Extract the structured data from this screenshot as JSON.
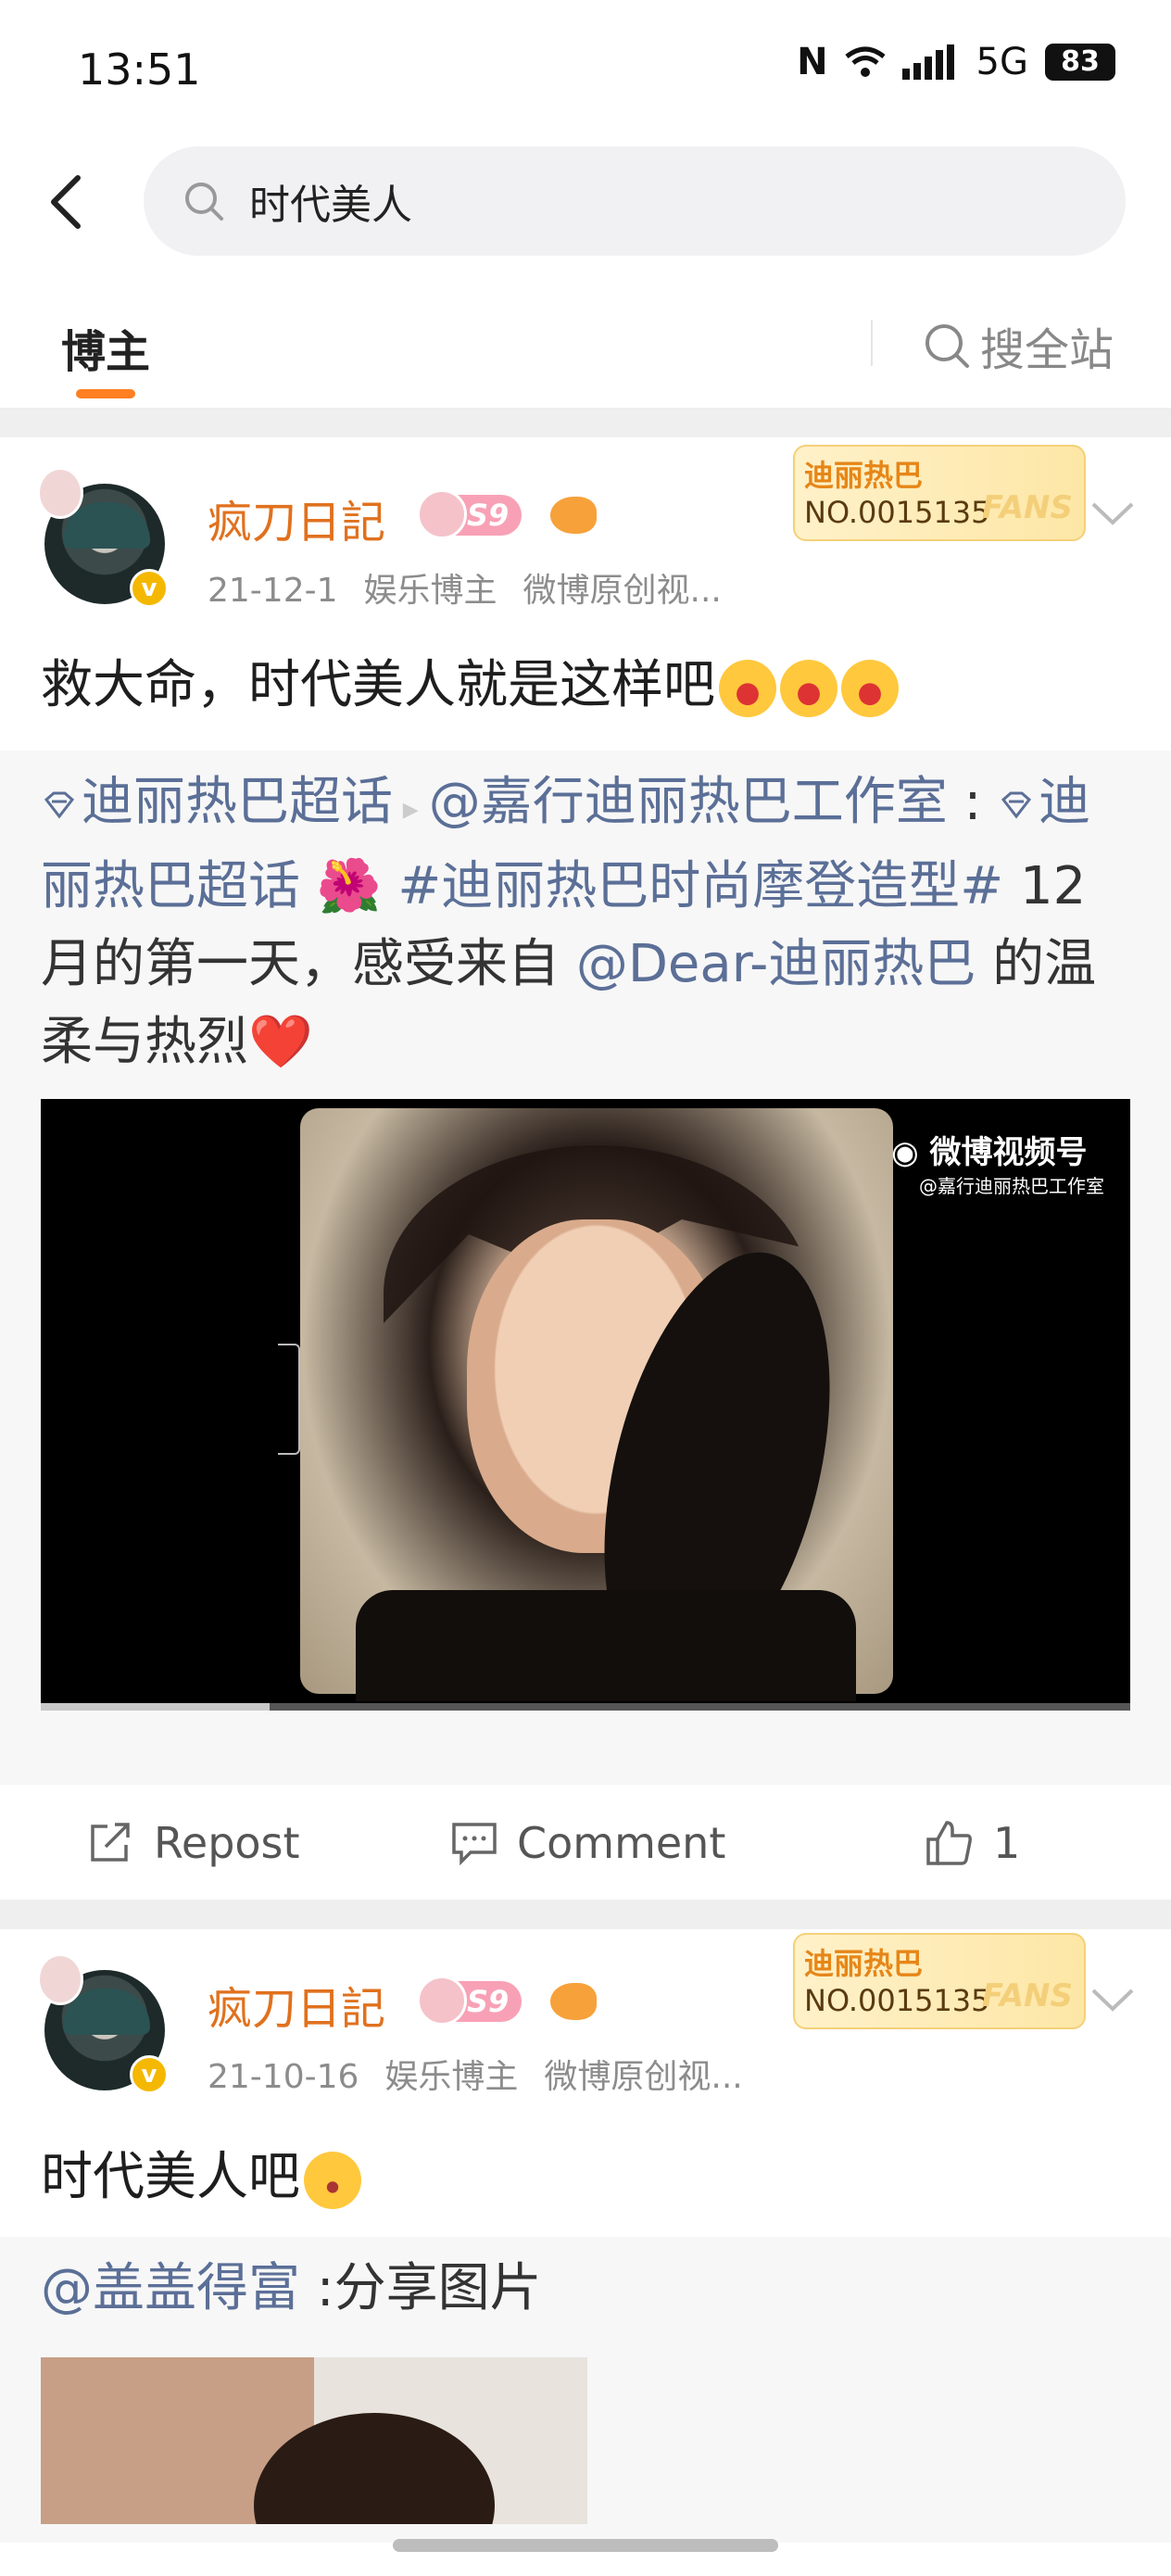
{
  "status_bar": {
    "time": "13:51",
    "network": "5G",
    "battery": "83"
  },
  "search": {
    "query": "时代美人"
  },
  "tabs": {
    "active": "博主",
    "search_all": "搜全站"
  },
  "posts": [
    {
      "username": "疯刀日記",
      "level": "S9",
      "fans_card": {
        "title": "迪丽热巴",
        "number": "NO.0015135",
        "label": "FANS"
      },
      "date": "21-12-1",
      "tag1": "娱乐博主",
      "tag2": "微博原创视...",
      "text": "救大命，时代美人就是这样吧",
      "repost_segments": [
        {
          "text": "迪丽热巴超话",
          "link": true
        },
        {
          "text": " ▸ ",
          "link": false
        },
        {
          "text": "@嘉行迪丽热巴工作室",
          "link": true
        },
        {
          "text": " :",
          "link": false
        },
        {
          "text": "迪丽热巴超话",
          "link": true
        },
        {
          "text": " 🌺 ",
          "link": false
        },
        {
          "text": "#迪丽热巴时尚摩登造型#",
          "link": true
        },
        {
          "text": " 12月的第一天，感受来自 ",
          "link": false
        },
        {
          "text": "@Dear-迪丽热巴",
          "link": true
        },
        {
          "text": " 的温柔与热烈❤️",
          "link": false
        }
      ],
      "video": {
        "brand": "微博视频号",
        "handle": "@嘉行迪丽热巴工作室",
        "progress": 0.21
      },
      "actions": {
        "repost": "Repost",
        "comment": "Comment",
        "likes": "1"
      }
    },
    {
      "username": "疯刀日記",
      "level": "S9",
      "fans_card": {
        "title": "迪丽热巴",
        "number": "NO.0015135",
        "label": "FANS"
      },
      "date": "21-10-16",
      "tag1": "娱乐博主",
      "tag2": "微博原创视...",
      "text": "时代美人吧",
      "repost_segments": [
        {
          "text": "@盖盖得富",
          "link": true
        },
        {
          "text": " :分享图片",
          "link": false
        }
      ]
    }
  ],
  "colors": {
    "accent": "#ff7f22",
    "username": "#e0711e",
    "link": "#5b6f97"
  }
}
